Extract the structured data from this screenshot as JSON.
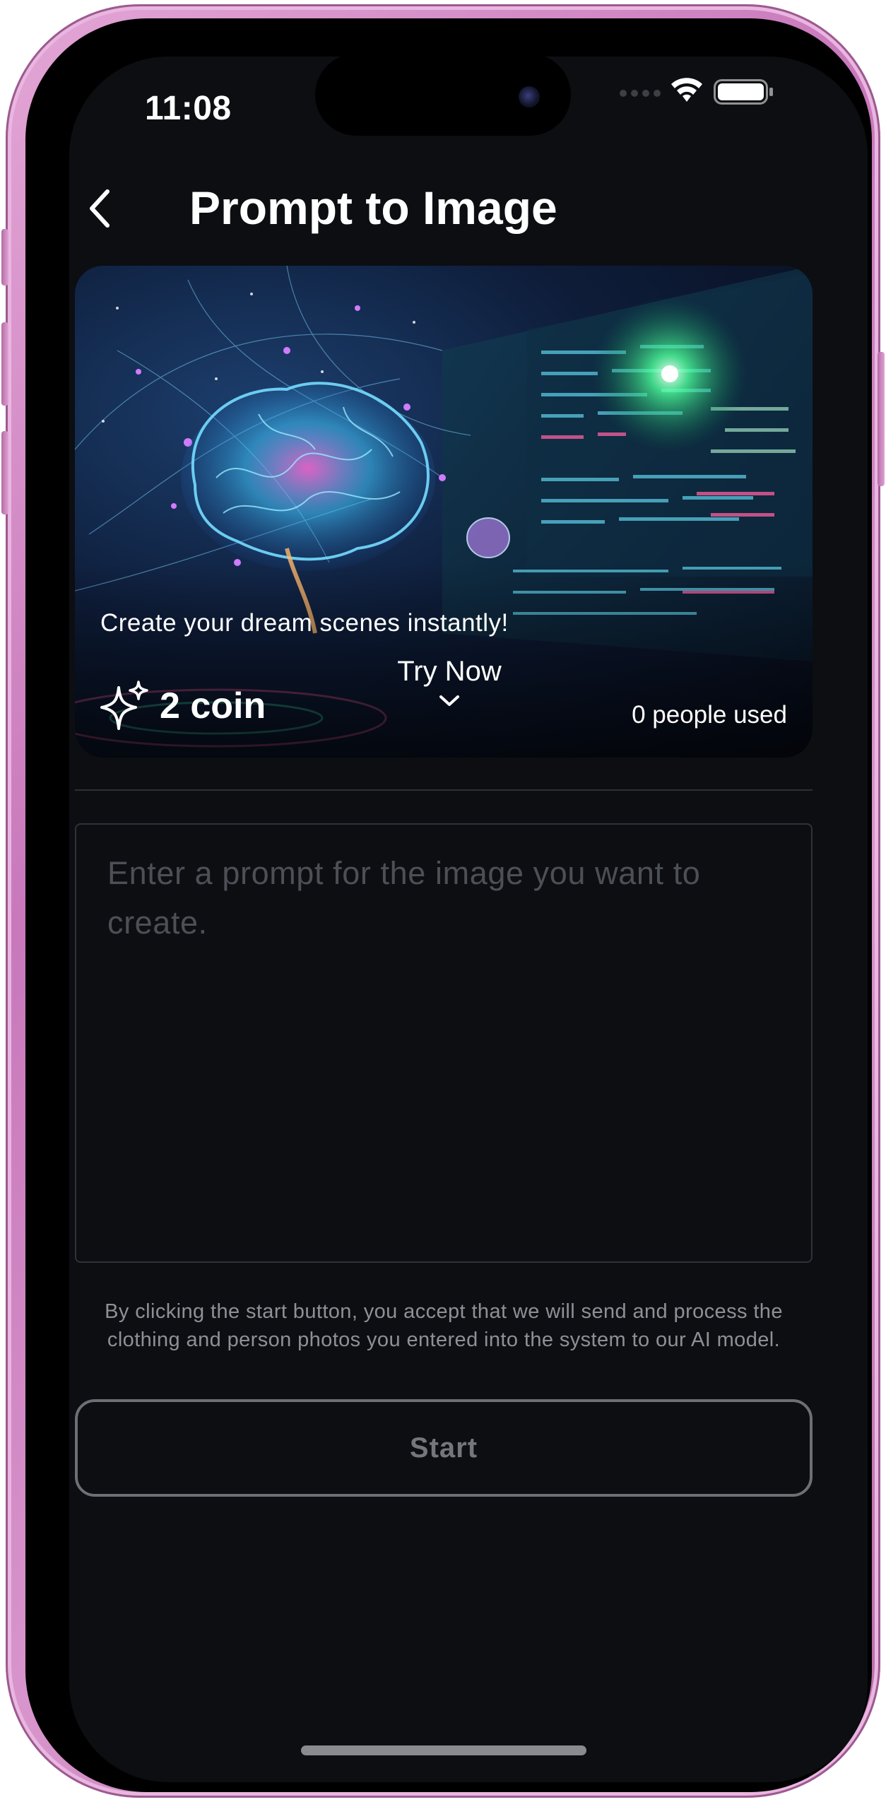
{
  "status_bar": {
    "time": "11:08",
    "icons": [
      "signal-dots-icon",
      "wifi-icon",
      "battery-icon"
    ]
  },
  "header": {
    "back_icon": "chevron-left-icon",
    "title": "Prompt to Image"
  },
  "banner": {
    "tagline": "Create your dream scenes instantly!",
    "coin_icon": "sparkles-icon",
    "coin_label": "2 coin",
    "try_now_label": "Try Now",
    "try_now_icon": "chevron-down-icon",
    "people_used": "0 people used"
  },
  "prompt": {
    "value": "",
    "placeholder": "Enter a prompt for the image you want to create."
  },
  "disclaimer": "By clicking the start button, you accept that we will send and process the clothing and person photos you entered into the system to our AI model.",
  "start_button": {
    "label": "Start"
  },
  "colors": {
    "background": "#0c0e12",
    "device_frame": "#d38cc8",
    "border": "#2f3238",
    "button_border": "#6d6f74",
    "muted_text": "#8e9096"
  }
}
